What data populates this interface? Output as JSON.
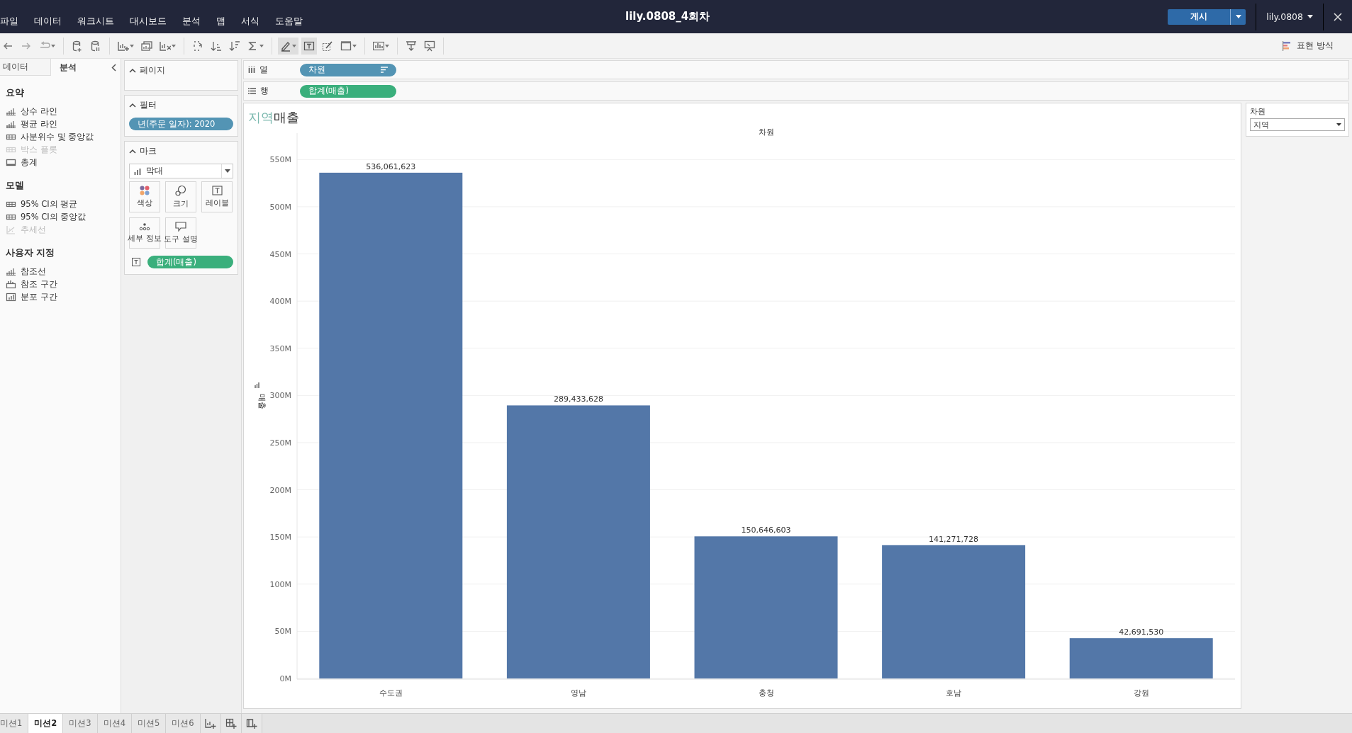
{
  "header": {
    "menu": [
      "파일",
      "데이터",
      "워크시트",
      "대시보드",
      "분석",
      "맵",
      "서식",
      "도움말"
    ],
    "title": "lily.0808_4회차",
    "publish": "게시",
    "user": "lily.0808"
  },
  "toolbar": {
    "groups": [
      [
        {
          "kind": "undo",
          "pressed": false
        },
        {
          "kind": "redo",
          "pressed": false
        },
        {
          "kind": "replay",
          "pressed": false
        }
      ],
      [
        {
          "kind": "new-datasource",
          "pressed": false
        },
        {
          "kind": "pause",
          "pressed": false
        }
      ],
      [
        {
          "kind": "new-sheet",
          "pressed": false
        },
        {
          "kind": "duplicate",
          "pressed": false
        },
        {
          "kind": "clear",
          "pressed": false
        }
      ],
      [
        {
          "kind": "swap",
          "pressed": false
        },
        {
          "kind": "sort-asc",
          "pressed": false
        },
        {
          "kind": "sort-desc",
          "pressed": false
        },
        {
          "kind": "totals",
          "pressed": false
        }
      ],
      [
        {
          "kind": "highlight",
          "pressed": true
        },
        {
          "kind": "label",
          "pressed": true
        },
        {
          "kind": "annotate",
          "pressed": false
        },
        {
          "kind": "fit",
          "pressed": false
        }
      ],
      [
        {
          "kind": "chart",
          "pressed": false
        }
      ],
      [
        {
          "kind": "download",
          "pressed": false
        },
        {
          "kind": "presentation",
          "pressed": false
        }
      ]
    ],
    "show_me": "표현 방식"
  },
  "side_panel": {
    "tabs": [
      {
        "label": "데이터",
        "selected": false
      },
      {
        "label": "분석",
        "selected": true
      }
    ],
    "sections": [
      {
        "title": "요약",
        "items": [
          {
            "label": "상수 라인",
            "disabled": false
          },
          {
            "label": "평균 라인",
            "disabled": false
          },
          {
            "label": "사분위수 및 중앙값",
            "disabled": false
          },
          {
            "label": "박스 플롯",
            "disabled": true
          },
          {
            "label": "총계",
            "disabled": false
          }
        ]
      },
      {
        "title": "모델",
        "items": [
          {
            "label": "95% CI의 평균",
            "disabled": false
          },
          {
            "label": "95% CI의 중앙값",
            "disabled": false
          },
          {
            "label": "추세선",
            "disabled": true
          }
        ]
      },
      {
        "title": "사용자 지정",
        "items": [
          {
            "label": "참조선",
            "disabled": false
          },
          {
            "label": "참조 구간",
            "disabled": false
          },
          {
            "label": "분포 구간",
            "disabled": false
          }
        ]
      }
    ]
  },
  "cards": {
    "pages": {
      "title": "페이지"
    },
    "filters": {
      "title": "필터",
      "pills": [
        "년(주문 일자): 2020"
      ]
    },
    "marks": {
      "title": "마크",
      "type": "막대",
      "buttons": [
        {
          "kind": "color",
          "label": "색상"
        },
        {
          "kind": "size",
          "label": "크기"
        },
        {
          "kind": "label",
          "label": "레이블"
        },
        {
          "kind": "detail",
          "label": "세부 정보"
        },
        {
          "kind": "tooltip",
          "label": "도구 설명"
        }
      ],
      "label_pill": "합계(매출)"
    }
  },
  "shelves": [
    {
      "kind": "columns",
      "label": "열",
      "pill": "차원"
    },
    {
      "kind": "rows",
      "label": "행",
      "pill": "합계(매출)"
    }
  ],
  "view": {
    "title_field": "지역",
    "title_rest": "매출",
    "chart_data": {
      "type": "bar",
      "title": "차원",
      "ylabel": "매출",
      "categories": [
        "수도권",
        "영남",
        "충청",
        "호남",
        "강원"
      ],
      "series": [
        {
          "color": "#5377a8",
          "values": [
            536061623,
            289433628,
            150646603,
            141271728,
            42691530
          ]
        }
      ],
      "value_labels": [
        "536,061,623",
        "289,433,628",
        "150,646,603",
        "141,271,728",
        "42,691,530"
      ],
      "grid": true,
      "ylim": [
        0,
        575000000
      ],
      "yticks": [
        {
          "value": 0,
          "label": "0M"
        },
        {
          "value": 50000000,
          "label": "50M"
        },
        {
          "value": 100000000,
          "label": "100M"
        },
        {
          "value": 150000000,
          "label": "150M"
        },
        {
          "value": 200000000,
          "label": "200M"
        },
        {
          "value": 250000000,
          "label": "250M"
        },
        {
          "value": 300000000,
          "label": "300M"
        },
        {
          "value": 350000000,
          "label": "350M"
        },
        {
          "value": 400000000,
          "label": "400M"
        },
        {
          "value": 450000000,
          "label": "450M"
        },
        {
          "value": 500000000,
          "label": "500M"
        },
        {
          "value": 550000000,
          "label": "550M"
        }
      ],
      "orientation": "vertical"
    }
  },
  "legend": {
    "title": "차원",
    "value": "지역"
  },
  "sheet_tabs": [
    {
      "label": "미션1",
      "selected": false
    },
    {
      "label": "미션2",
      "selected": true
    },
    {
      "label": "미션3",
      "selected": false
    },
    {
      "label": "미션4",
      "selected": false
    },
    {
      "label": "미션5",
      "selected": false
    },
    {
      "label": "미션6",
      "selected": false
    }
  ],
  "sheet_actions": [
    {
      "kind": "new-worksheet"
    },
    {
      "kind": "new-dashboard"
    },
    {
      "kind": "new-story"
    }
  ]
}
